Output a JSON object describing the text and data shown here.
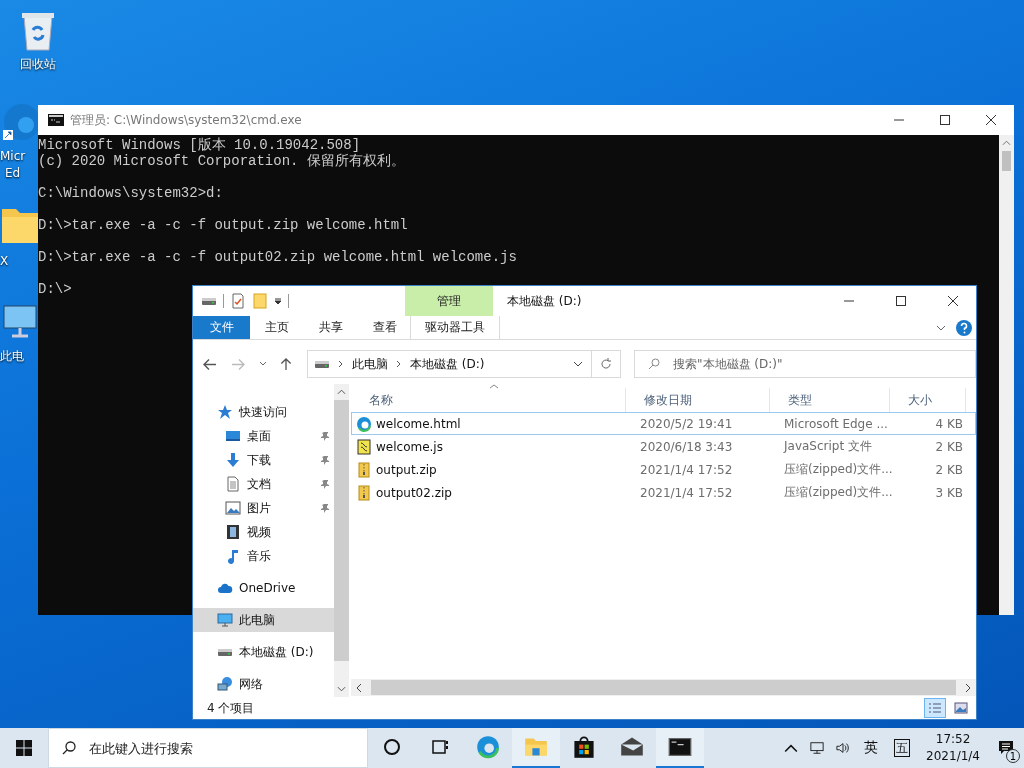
{
  "desktop_icons": [
    {
      "kind": "recycle",
      "lines": [
        "回收站"
      ]
    },
    {
      "kind": "edge",
      "lines": [
        "Micr",
        "Ed"
      ]
    },
    {
      "kind": "folder",
      "lines": [
        "X"
      ]
    },
    {
      "kind": "pc",
      "lines": [
        "此电"
      ]
    }
  ],
  "cmd_window": {
    "title": "管理员: C:\\Windows\\system32\\cmd.exe",
    "paragraphs": [
      [
        "Microsoft Windows [版本 10.0.19042.508]",
        "(c) 2020 Microsoft Corporation. 保留所有权利。"
      ],
      [
        "C:\\Windows\\system32>d:"
      ],
      [
        "D:\\>tar.exe -a -c -f output.zip welcome.html"
      ],
      [
        "D:\\>tar.exe -a -c -f output02.zip welcome.html welcome.js"
      ],
      [
        "D:\\>"
      ]
    ]
  },
  "explorer": {
    "title": "本地磁盘 (D:)",
    "context_group": "管理",
    "ribbon_tabs": [
      {
        "label": "文件",
        "kind": "file"
      },
      {
        "label": "主页",
        "kind": "plain"
      },
      {
        "label": "共享",
        "kind": "plain"
      },
      {
        "label": "查看",
        "kind": "plain"
      },
      {
        "label": "驱动器工具",
        "kind": "contextual"
      }
    ],
    "address": {
      "path": [
        "此电脑",
        "本地磁盘 (D:)"
      ]
    },
    "search": {
      "placeholder": "搜索\"本地磁盘 (D:)\""
    },
    "nav": [
      {
        "label": "快速访问",
        "kind": "star",
        "selected": false,
        "children": [
          {
            "label": "桌面",
            "kind": "desktop",
            "selected": false,
            "pinned": true
          },
          {
            "label": "下载",
            "kind": "download",
            "selected": false,
            "pinned": true
          },
          {
            "label": "文档",
            "kind": "doc",
            "selected": false,
            "pinned": true
          },
          {
            "label": "图片",
            "kind": "image",
            "selected": false,
            "pinned": true
          },
          {
            "label": "视频",
            "kind": "video",
            "selected": false,
            "pinned": false
          },
          {
            "label": "音乐",
            "kind": "music",
            "selected": false,
            "pinned": false
          }
        ]
      },
      {
        "label": "OneDrive",
        "kind": "cloud",
        "selected": false
      },
      {
        "label": "此电脑",
        "kind": "pc",
        "selected": true
      },
      {
        "label": "本地磁盘 (D:)",
        "kind": "drive",
        "selected": false
      },
      {
        "label": "网络",
        "kind": "network",
        "selected": false
      }
    ],
    "columns": [
      "名称",
      "修改日期",
      "类型",
      "大小"
    ],
    "rows": [
      {
        "name": "welcome.html",
        "date": "2020/5/2 19:41",
        "type": "Microsoft Edge ...",
        "size": "4 KB",
        "kind": "edge",
        "focused": true
      },
      {
        "name": "welcome.js",
        "date": "2020/6/18 3:43",
        "type": "JavaScript 文件",
        "size": "2 KB",
        "kind": "script",
        "focused": false
      },
      {
        "name": "output.zip",
        "date": "2021/1/4 17:52",
        "type": "压缩(zipped)文件...",
        "size": "2 KB",
        "kind": "zip",
        "focused": false
      },
      {
        "name": "output02.zip",
        "date": "2021/1/4 17:52",
        "type": "压缩(zipped)文件...",
        "size": "3 KB",
        "kind": "zip",
        "focused": false
      }
    ],
    "status": "4 个项目",
    "views": [
      {
        "kind": "details",
        "selected": true
      },
      {
        "kind": "large",
        "selected": false
      }
    ]
  },
  "taskbar": {
    "search": {
      "placeholder": "在此键入进行搜索"
    },
    "apps": [
      {
        "kind": "cortana",
        "active": false
      },
      {
        "kind": "taskview",
        "active": false
      },
      {
        "kind": "edge",
        "active": false
      },
      {
        "kind": "explorer",
        "active": true
      },
      {
        "kind": "store",
        "active": false
      },
      {
        "kind": "mail",
        "active": false
      },
      {
        "kind": "cmd",
        "active": true
      }
    ],
    "ime": [
      "英",
      "五"
    ],
    "time": "17:52",
    "date": "2021/1/4",
    "notifications": "1"
  }
}
